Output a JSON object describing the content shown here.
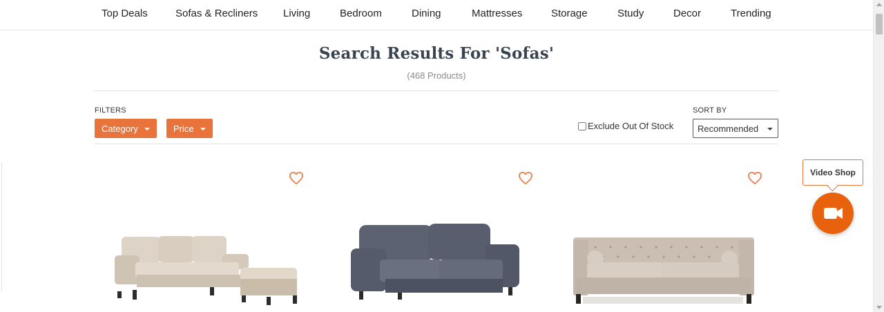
{
  "nav": {
    "items": [
      "Top Deals",
      "Sofas & Recliners",
      "Living",
      "Bedroom",
      "Dining",
      "Mattresses",
      "Storage",
      "Study",
      "Decor",
      "Trending"
    ]
  },
  "search": {
    "title": "Search Results For 'Sofas'",
    "count": "(468 Products)"
  },
  "filters": {
    "label": "FILTERS",
    "category_label": "Category",
    "price_label": "Price",
    "exclude_label": "Exclude Out Of Stock",
    "exclude_checked": false
  },
  "sort": {
    "label": "SORT BY",
    "selected": "Recommended"
  },
  "video_shop": {
    "label": "Video Shop"
  },
  "colors": {
    "accent": "#e8743b",
    "video_button": "#e8620d",
    "title": "#3a4350"
  },
  "icons": {
    "wishlist": "heart-outline-icon",
    "video": "video-camera-icon",
    "dropdown": "caret-down-icon"
  }
}
